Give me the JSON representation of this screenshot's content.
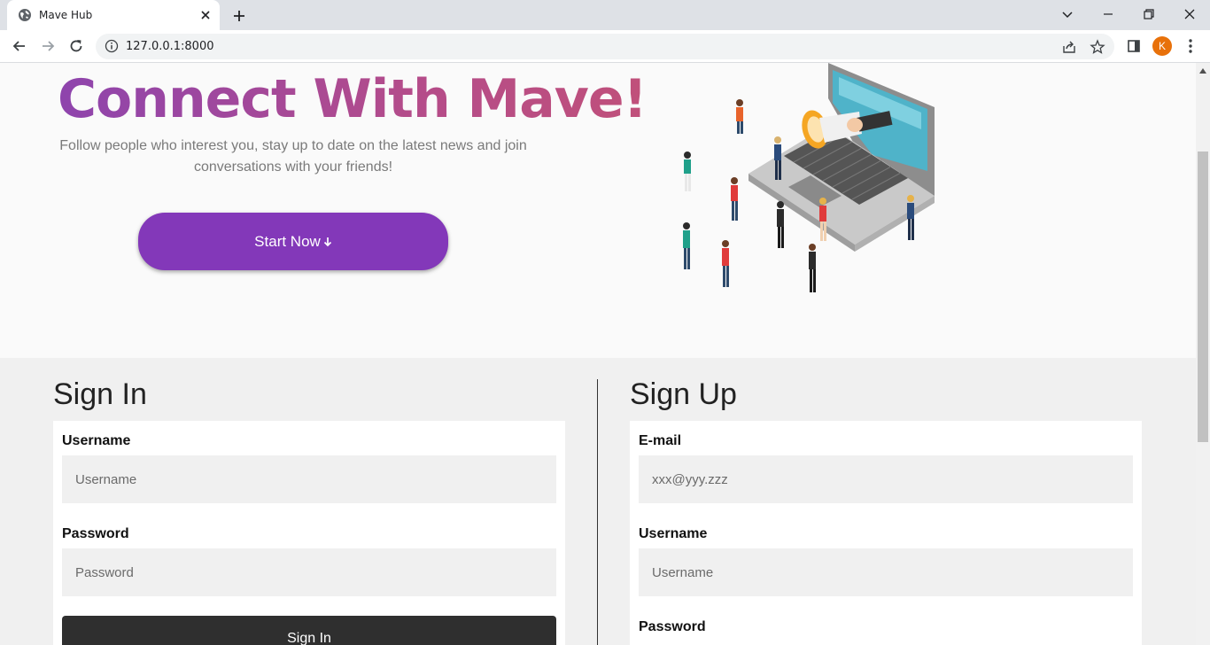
{
  "browser": {
    "tab_title": "Mave Hub",
    "url": "127.0.0.1:8000",
    "profile_initial": "K"
  },
  "hero": {
    "title": "Connect With Mave!",
    "subtitle": "Follow people who interest you, stay up to date on the latest news and join conversations with your friends!",
    "start_button": "Start Now",
    "title_gradient": [
      "#8e44ad",
      "#c0507a"
    ],
    "button_color": "#8338b9"
  },
  "signin": {
    "title": "Sign In",
    "username_label": "Username",
    "username_placeholder": "Username",
    "password_label": "Password",
    "password_placeholder": "Password",
    "submit_label": "Sign In"
  },
  "signup": {
    "title": "Sign Up",
    "email_label": "E-mail",
    "email_placeholder": "xxx@yyy.zzz",
    "username_label": "Username",
    "username_placeholder": "Username",
    "password_label": "Password"
  },
  "icons": [
    "globe-icon",
    "close-icon",
    "plus-icon",
    "chevron-down-icon",
    "minimize-icon",
    "restore-icon",
    "back-icon",
    "forward-icon",
    "reload-icon",
    "info-icon",
    "share-icon",
    "star-icon",
    "sidepanel-icon",
    "kebab-menu-icon",
    "arrow-down-icon"
  ]
}
